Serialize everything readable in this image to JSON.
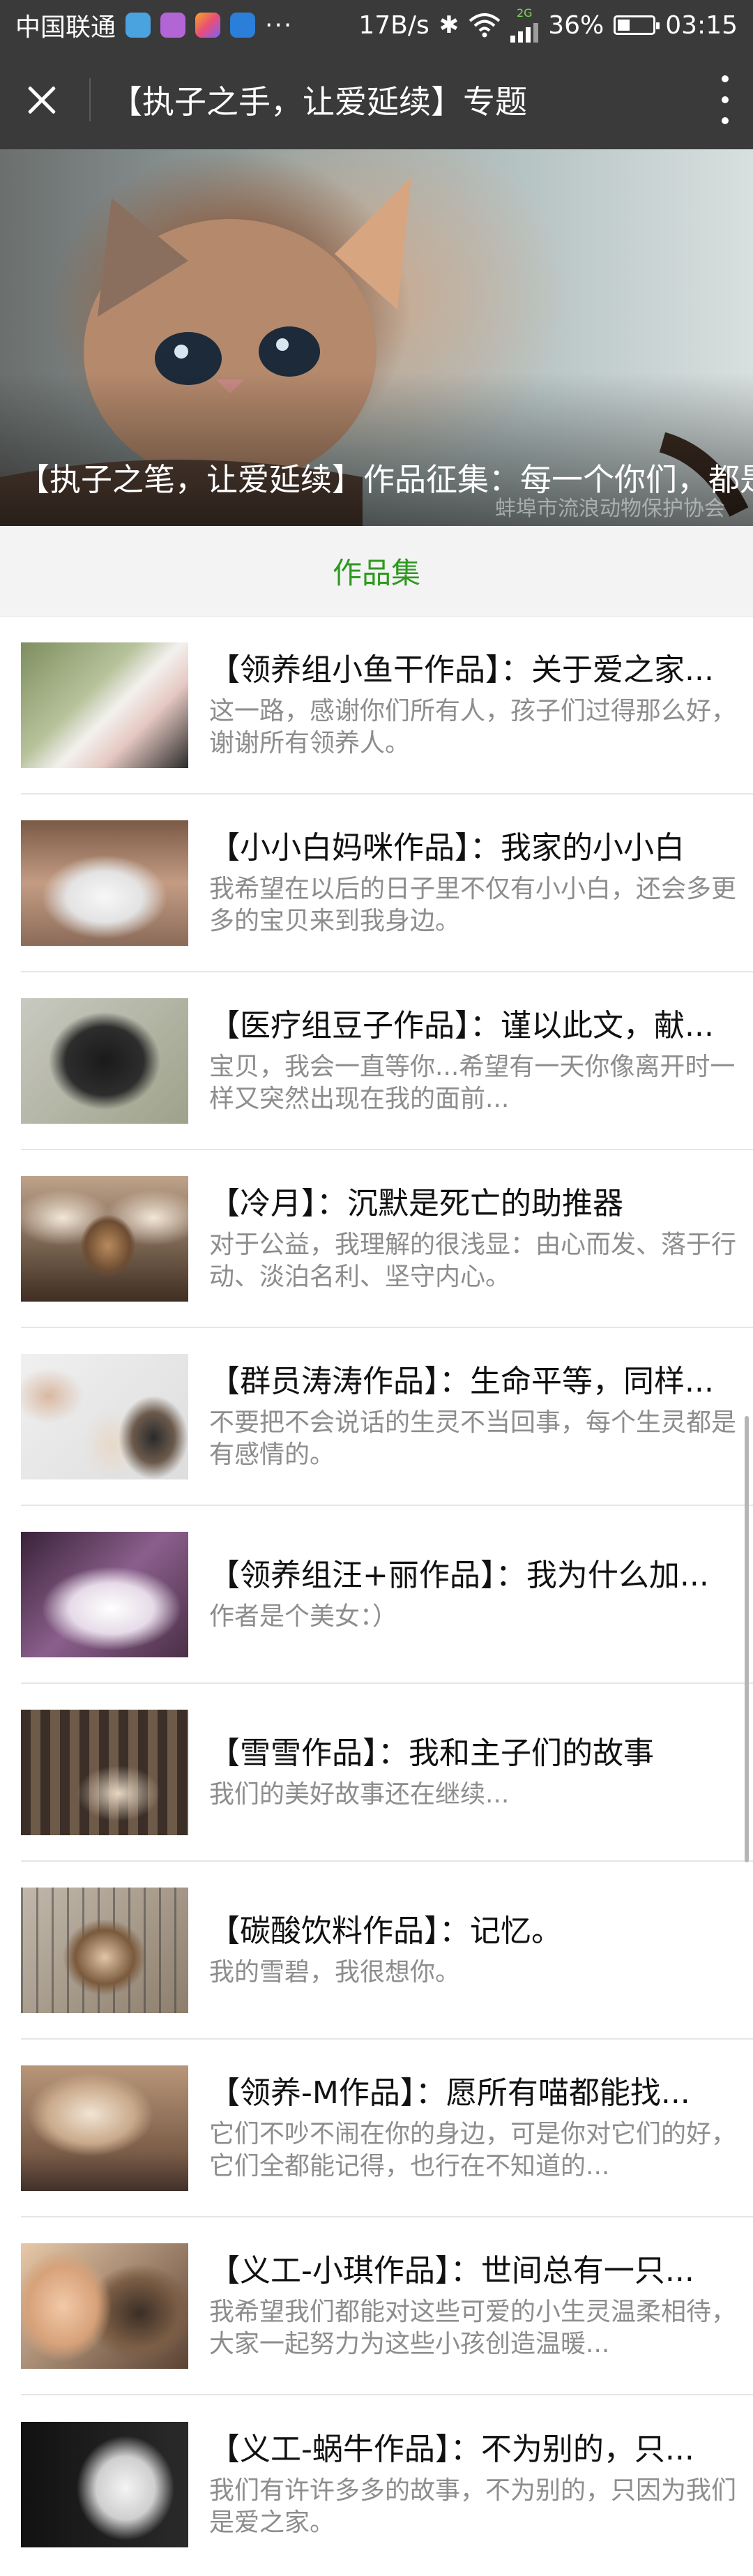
{
  "status_bar": {
    "carrier": "中国联通",
    "dots": "···",
    "net_speed": "17B/s",
    "network_type": "2G",
    "battery": "36%",
    "battery_level": 0.36,
    "time": "03:15"
  },
  "titlebar": {
    "title": "【执子之手，让爱延续】专题"
  },
  "banner": {
    "caption": "【执子之笔，让爱延续】作品征集：每一个你们，都是我们的骄傲",
    "watermark": "蚌埠市流浪动物保护协会"
  },
  "section": {
    "title": "作品集",
    "accent_color": "#2e9a1f"
  },
  "items": [
    {
      "title": "【领养组小鱼干作品】：关于爱之家...",
      "desc": "这一路，感谢你们所有人，孩子们过得那么好，谢谢所有领养人。"
    },
    {
      "title": "【小小白妈咪作品】：我家的小小白",
      "desc": "我希望在以后的日子里不仅有小小白，还会多更多的宝贝来到我身边。"
    },
    {
      "title": "【医疗组豆子作品】：谨以此文，献...",
      "desc": "宝贝，我会一直等你...希望有一天你像离开时一样又突然出现在我的面前..."
    },
    {
      "title": "【冷月】：沉默是死亡的助推器",
      "desc": "对于公益，我理解的很浅显：由心而发、落于行动、淡泊名利、坚守内心。"
    },
    {
      "title": "【群员涛涛作品】：生命平等，同样...",
      "desc": "不要把不会说话的生灵不当回事，每个生灵都是有感情的。"
    },
    {
      "title": "【领养组汪+丽作品】：我为什么加...",
      "desc": "作者是个美女：）"
    },
    {
      "title": "【雪雪作品】：我和主子们的故事",
      "desc": "我们的美好故事还在继续..."
    },
    {
      "title": "【碳酸饮料作品】：记忆。",
      "desc": "我的雪碧，我很想你。"
    },
    {
      "title": "【领养-M作品】：愿所有喵都能找...",
      "desc": "它们不吵不闹在你的身边，可是你对它们的好，它们全都能记得，也行在不知道的..."
    },
    {
      "title": "【义工-小琪作品】：世间总有一只...",
      "desc": "我希望我们都能对这些可爱的小生灵温柔相待，大家一起努力为这些小孩创造温暖..."
    },
    {
      "title": "【义工-蜗牛作品】：不为别的，只...",
      "desc": "我们有许许多多的故事，不为别的，只因为我们是爱之家。"
    }
  ]
}
